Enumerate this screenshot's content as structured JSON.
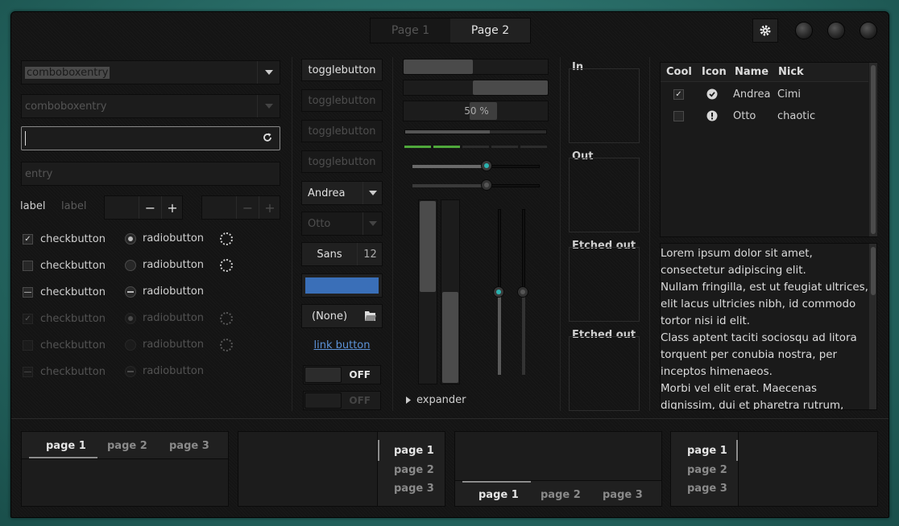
{
  "header": {
    "tabs": [
      {
        "label": "Page 1",
        "active": false
      },
      {
        "label": "Page 2",
        "active": true
      }
    ],
    "settings_icon": "gear-icon"
  },
  "col1": {
    "combo1_value": "comboboxentry",
    "combo2_value": "comboboxentry",
    "entry_value": "",
    "entry_placeholder": "entry",
    "label1": "label",
    "label2": "label",
    "checks": [
      {
        "check_label": "checkbutton",
        "check_state": "checked",
        "radio_label": "radiobutton",
        "radio_state": "checked",
        "enabled": true
      },
      {
        "check_label": "checkbutton",
        "check_state": "unchecked",
        "radio_label": "radiobutton",
        "radio_state": "unchecked",
        "enabled": true
      },
      {
        "check_label": "checkbutton",
        "check_state": "mixed",
        "radio_label": "radiobutton",
        "radio_state": "mixed",
        "enabled": true
      },
      {
        "check_label": "checkbutton",
        "check_state": "checked",
        "radio_label": "radiobutton",
        "radio_state": "checked",
        "enabled": false
      },
      {
        "check_label": "checkbutton",
        "check_state": "unchecked",
        "radio_label": "radiobutton",
        "radio_state": "unchecked",
        "enabled": false
      },
      {
        "check_label": "checkbutton",
        "check_state": "mixed",
        "radio_label": "radiobutton",
        "radio_state": "mixed",
        "enabled": false
      }
    ]
  },
  "col2": {
    "toggles": [
      "togglebutton",
      "togglebutton",
      "togglebutton",
      "togglebutton"
    ],
    "combo_andrea": "Andrea",
    "combo_otto": "Otto",
    "font_name": "Sans",
    "font_size": "12",
    "color_value": "#3a6fb8",
    "file_value": "(None)",
    "link_label": "link button",
    "switch1_label": "OFF",
    "switch2_label": "OFF"
  },
  "col3": {
    "progress1": 0.48,
    "progress2": 0.52,
    "progress3_text": "50 %",
    "progress3": 0.5,
    "level1": 0.6,
    "level_segments": [
      1,
      1,
      0,
      0,
      0
    ],
    "scale1": 0.58,
    "scale2": 0.58,
    "vprogress1": 0.5,
    "vprogress2": 0.5,
    "vscale1": 0.5,
    "vscale2": 0.5,
    "expander_label": "expander"
  },
  "frames": [
    "In",
    "Out",
    "Etched out",
    "Etched out"
  ],
  "tree": {
    "columns": [
      "Cool",
      "Icon",
      "Name",
      "Nick"
    ],
    "rows": [
      {
        "cool": true,
        "icon": "checkmark-circle-icon",
        "name": "Andrea",
        "nick": "Cimi"
      },
      {
        "cool": false,
        "icon": "alert-circle-icon",
        "name": "Otto",
        "nick": "chaotic"
      }
    ]
  },
  "textview": {
    "lines": [
      "Lorem ipsum dolor sit amet,",
      "consectetur adipiscing elit.",
      "Nullam fringilla, est ut feugiat ultrices,",
      "elit lacus ultricies nibh, id commodo",
      "tortor nisi id elit.",
      "Class aptent taciti sociosqu ad litora",
      "torquent per conubia nostra, per",
      "inceptos himenaeos.",
      "Morbi vel elit erat. Maecenas",
      "dignissim, dui et pharetra rutrum,"
    ]
  },
  "notebooks": {
    "nb1": [
      "page 1",
      "page 2",
      "page 3"
    ],
    "nb2": [
      "page 1",
      "page 2",
      "page 3"
    ],
    "nb3": [
      "page 1",
      "page 2",
      "page 3"
    ],
    "nb4": [
      "page 1",
      "page 2",
      "page 3"
    ]
  }
}
